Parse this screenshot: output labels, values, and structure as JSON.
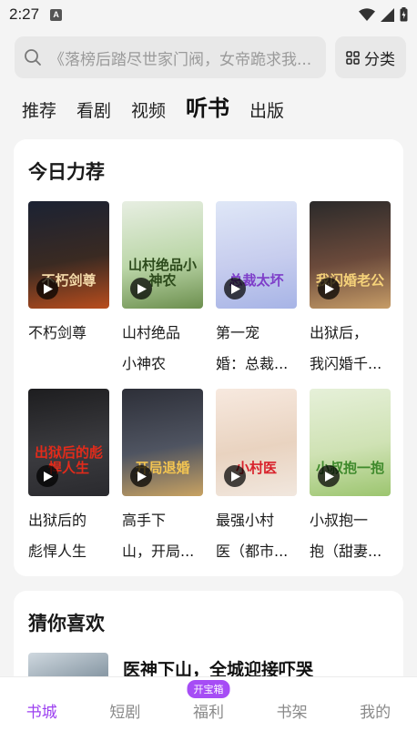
{
  "status_bar": {
    "time": "2:27",
    "notification_letter": "A"
  },
  "search": {
    "placeholder": "《落榜后踏尽世家门阀，女帝跪求我..."
  },
  "category_button": {
    "label": "分类",
    "icon": "grid-icon"
  },
  "tabs": [
    {
      "label": "推荐",
      "active": false
    },
    {
      "label": "看剧",
      "active": false
    },
    {
      "label": "视频",
      "active": false
    },
    {
      "label": "听书",
      "active": true
    },
    {
      "label": "出版",
      "active": false
    }
  ],
  "recommend": {
    "title": "今日力荐",
    "books": [
      {
        "title_line1": "不朽剑尊",
        "title_line2": "",
        "cover_text": "不朽剑尊",
        "cover_colors": [
          "#1b2233",
          "#3a2a22",
          "#b94d1d"
        ],
        "cover_text_color": "#f3d9a8"
      },
      {
        "title_line1": "山村绝品",
        "title_line2": "小神农",
        "cover_text": "山村绝品小神农",
        "cover_colors": [
          "#e7eee2",
          "#bcd7a9",
          "#6c8f4e"
        ],
        "cover_text_color": "#2c4a1b"
      },
      {
        "title_line1": "第一宠",
        "title_line2": "婚：总裁...",
        "cover_text": "总裁太坏",
        "cover_colors": [
          "#dfe7f7",
          "#c7cdee",
          "#a7b4e6"
        ],
        "cover_text_color": "#7e3ec9"
      },
      {
        "title_line1": "出狱后，",
        "title_line2": "我闪婚千...",
        "cover_text": "我闪婚老公",
        "cover_colors": [
          "#2b2a2a",
          "#6b4a3b",
          "#c69c67"
        ],
        "cover_text_color": "#f6d37a"
      },
      {
        "title_line1": "出狱后的",
        "title_line2": "彪悍人生",
        "cover_text": "出狱后的彪悍人生",
        "cover_colors": [
          "#1d1d1f",
          "#3b3b3f",
          "#2a2a2e"
        ],
        "cover_text_color": "#e12b1b"
      },
      {
        "title_line1": "高手下",
        "title_line2": "山，开局...",
        "cover_text": "开局退婚",
        "cover_colors": [
          "#2d2f38",
          "#4f5461",
          "#c8a262"
        ],
        "cover_text_color": "#f2c452"
      },
      {
        "title_line1": "最强小村",
        "title_line2": "医（都市...",
        "cover_text": "小村医",
        "cover_colors": [
          "#f7e9df",
          "#e9d3c0",
          "#f1e7de"
        ],
        "cover_text_color": "#d8212b"
      },
      {
        "title_line1": "小叔抱一",
        "title_line2": "抱（甜妻...",
        "cover_text": "小叔抱一抱",
        "cover_colors": [
          "#e6f0d9",
          "#cfe2b4",
          "#9cc56f"
        ],
        "cover_text_color": "#3f8a2c"
      }
    ]
  },
  "guess": {
    "title": "猜你喜欢",
    "first_item_title": "医神下山，全城迎接吓哭"
  },
  "bottom_nav": [
    {
      "label": "书城",
      "active": true,
      "badge": ""
    },
    {
      "label": "短剧",
      "active": false,
      "badge": ""
    },
    {
      "label": "福利",
      "active": false,
      "badge": "开宝箱"
    },
    {
      "label": "书架",
      "active": false,
      "badge": ""
    },
    {
      "label": "我的",
      "active": false,
      "badge": ""
    }
  ],
  "accent_color": "#9c40f0"
}
